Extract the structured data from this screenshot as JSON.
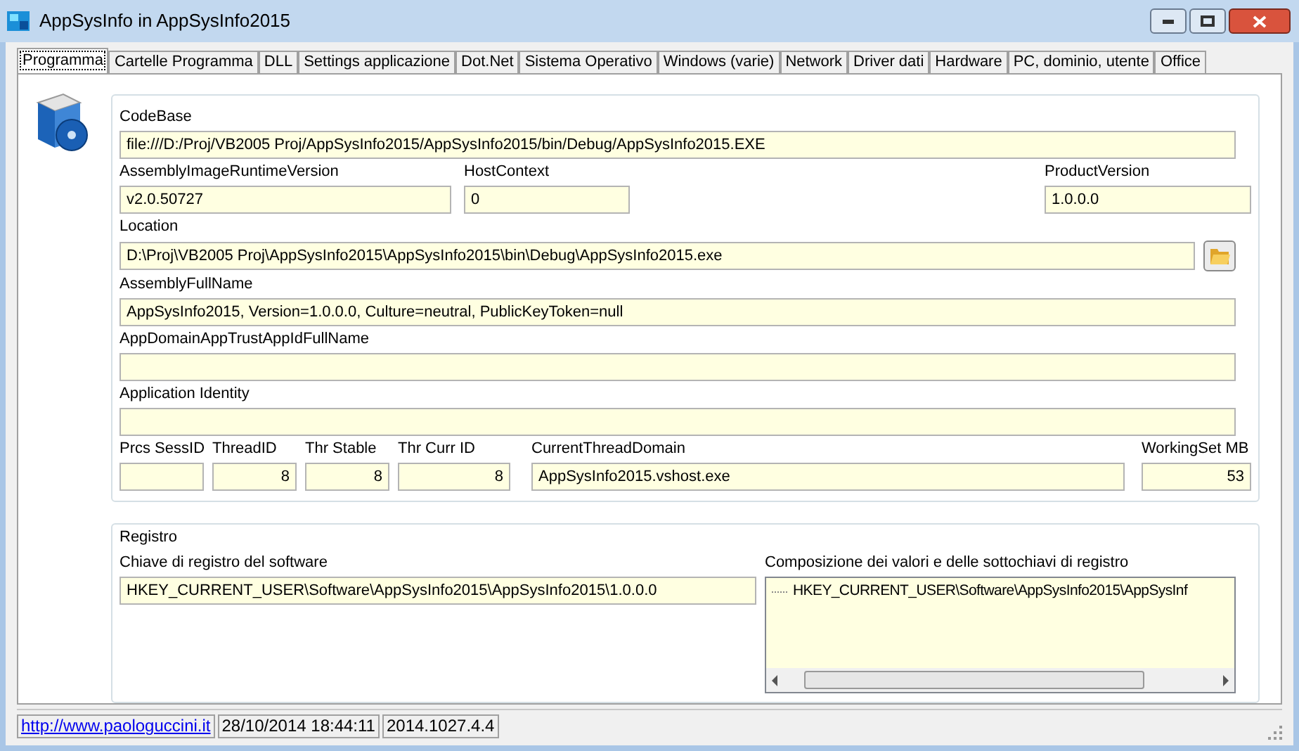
{
  "window": {
    "title": "AppSysInfo in AppSysInfo2015"
  },
  "tabs": [
    {
      "label": "Programma",
      "selected": true
    },
    {
      "label": "Cartelle Programma",
      "selected": false
    },
    {
      "label": "DLL",
      "selected": false
    },
    {
      "label": "Settings applicazione",
      "selected": false
    },
    {
      "label": "Dot.Net",
      "selected": false
    },
    {
      "label": "Sistema Operativo",
      "selected": false
    },
    {
      "label": "Windows (varie)",
      "selected": false
    },
    {
      "label": "Network",
      "selected": false
    },
    {
      "label": "Driver dati",
      "selected": false
    },
    {
      "label": "Hardware",
      "selected": false
    },
    {
      "label": "PC, dominio, utente",
      "selected": false
    },
    {
      "label": "Office",
      "selected": false
    }
  ],
  "program": {
    "codebase": {
      "label": "CodeBase",
      "value": "file:///D:/Proj/VB2005 Proj/AppSysInfo2015/AppSysInfo2015/bin/Debug/AppSysInfo2015.EXE"
    },
    "runtime_version": {
      "label": "AssemblyImageRuntimeVersion",
      "value": "v2.0.50727"
    },
    "host_context": {
      "label": "HostContext",
      "value": "0"
    },
    "product_version": {
      "label": "ProductVersion",
      "value": "1.0.0.0"
    },
    "location": {
      "label": "Location",
      "value": "D:\\Proj\\VB2005 Proj\\AppSysInfo2015\\AppSysInfo2015\\bin\\Debug\\AppSysInfo2015.exe"
    },
    "full_name": {
      "label": "AssemblyFullName",
      "value": "AppSysInfo2015, Version=1.0.0.0, Culture=neutral, PublicKeyToken=null"
    },
    "trust_app_id": {
      "label": "AppDomainAppTrustAppIdFullName"
    },
    "app_identity": {
      "label": "Application Identity"
    },
    "thread_fields": [
      {
        "label": "Prcs SessID",
        "kind": "number"
      },
      {
        "label": "ThreadID",
        "value": "8",
        "kind": "number"
      },
      {
        "label": "Thr Stable",
        "value": "8",
        "kind": "number"
      },
      {
        "label": "Thr Curr ID",
        "value": "8",
        "kind": "number"
      },
      {
        "label": "CurrentThreadDomain",
        "value": "AppSysInfo2015.vshost.exe",
        "kind": "text"
      },
      {
        "label": "WorkingSet MB",
        "value": "53",
        "kind": "number"
      }
    ]
  },
  "registry": {
    "title": "Registro",
    "key": {
      "label": "Chiave di registro del software",
      "value": "HKEY_CURRENT_USER\\Software\\AppSysInfo2015\\AppSysInfo2015\\1.0.0.0"
    },
    "tree": {
      "label": "Composizione dei valori e delle sottochiavi di registro",
      "items": [
        {
          "label": "HKEY_CURRENT_USER\\Software\\AppSysInfo2015\\AppSysInf"
        }
      ]
    }
  },
  "status_bar": {
    "link": "http://www.paologuccini.it",
    "date": "28/10/2014 18:44:11",
    "version": "2014.1027.4.4"
  }
}
